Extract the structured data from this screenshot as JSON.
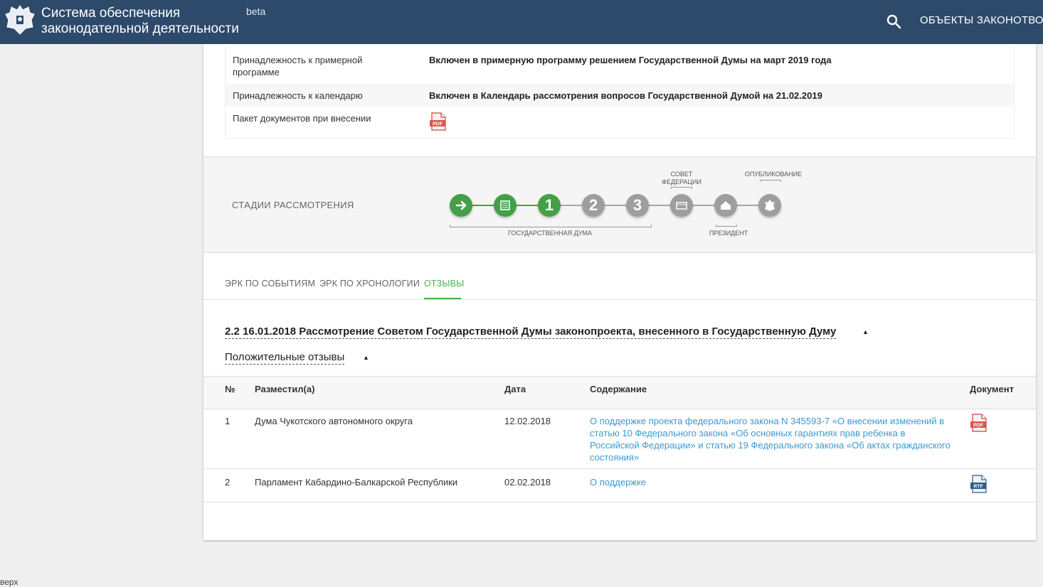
{
  "header": {
    "title_line1": "Система обеспечения",
    "title_line2": "законодательной деятельности",
    "beta": "beta",
    "nav_label": "ОБЪЕКТЫ ЗАКОНОТВОР",
    "bg_color": "#2d4a6b"
  },
  "info": {
    "rows": [
      {
        "label": "Принадлежность к примерной программе",
        "value": "Включен в примерную программу решением Государственной Думы на март 2019 года"
      },
      {
        "label": "Принадлежность к календарю",
        "value": "Включен в Календарь рассмотрения вопросов Государственной Думой на 21.02.2019"
      },
      {
        "label": "Пакет документов при внесении",
        "icon": "pdf-icon"
      }
    ]
  },
  "stages": {
    "label": "СТАДИИ РАССМОТРЕНИЯ",
    "duma_label": "ГОСУДАРСТВЕННАЯ ДУМА",
    "council_label_1": "СОВЕТ",
    "council_label_2": "ФЕДЕРАЦИИ",
    "president_label": "ПРЕЗИДЕНТ",
    "publication_label": "ОПУБЛИКОВАНИЕ",
    "step1": "1",
    "step2": "2",
    "step3": "3",
    "completed_color": "#43a047",
    "pending_color": "#9e9e9e"
  },
  "tabs": [
    {
      "label": "ЭРК ПО СОБЫТИЯМ"
    },
    {
      "label": "ЭРК ПО ХРОНОЛОГИИ"
    },
    {
      "label": "ОТЗЫВЫ"
    }
  ],
  "event": {
    "title": "2.2 16.01.2018 Рассмотрение Советом Государственной Думы законопроекта, внесенного в Государственную Думу",
    "subtitle": "Положительные отзывы"
  },
  "table": {
    "headers": [
      "№",
      "Разместил(а)",
      "Дата",
      "Содержание",
      "Документ"
    ],
    "rows": [
      {
        "num": "1",
        "author": "Дума Чукотского автономного округа",
        "date": "12.02.2018",
        "content": "О поддержке проекта федерального закона N 345593-7 «О внесении изменений в статью 10 Федерального закона «Об основных гарантиях прав ребенка в Российской Федерации» и статью 19 Федерального закона «Об актах гражданского состояния»",
        "doc": "pdf-icon",
        "doc_text": "PDF"
      },
      {
        "num": "2",
        "author": "Парламент Кабардино-Балкарской Республики",
        "date": "02.02.2018",
        "content": "О поддержке",
        "doc": "rtf-icon",
        "doc_text": "RTF"
      }
    ]
  },
  "footer": {
    "up_label": "верх"
  }
}
